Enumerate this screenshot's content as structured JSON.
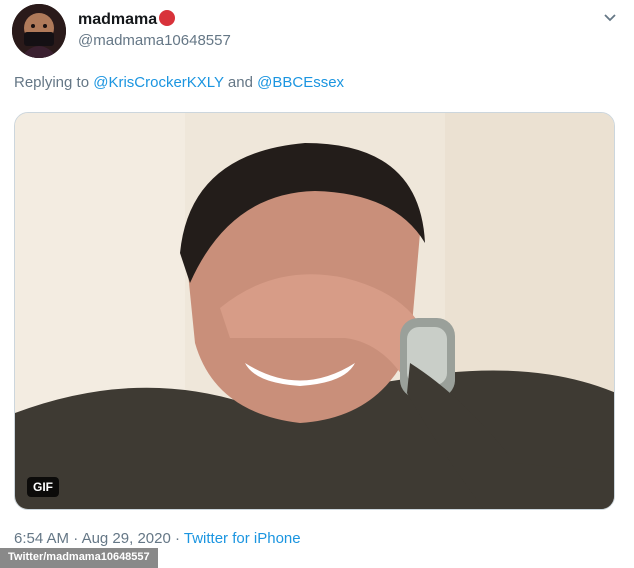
{
  "author": {
    "display_name": "madmama",
    "handle": "@madmama10648557"
  },
  "reply": {
    "prefix": "Replying to ",
    "mention_1": "@KrisCrockerKXLY",
    "conjunction": " and ",
    "mention_2": "@BBCEssex"
  },
  "media": {
    "badge": "GIF"
  },
  "meta": {
    "time": "6:54 AM",
    "separator_1": " · ",
    "date": "Aug 29, 2020",
    "separator_2": " · ",
    "source": "Twitter for iPhone"
  },
  "credit": "Twitter/madmama10648557",
  "colors": {
    "link": "#1b95e0",
    "secondary_text": "#657786",
    "emoji": "#d8323a"
  },
  "icons": {
    "avatar": "avatar",
    "emoji": "angry-face-icon",
    "caret": "chevron-down-icon"
  }
}
